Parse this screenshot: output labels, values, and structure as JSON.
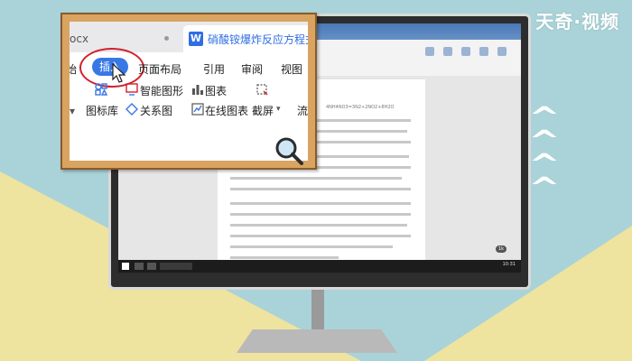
{
  "watermark": "天奇·视频",
  "wps_window": {
    "doc_tab_left": "ocx",
    "doc_tab_title": "硝酸铵爆炸反应方程式",
    "tab_icon_letter": "W",
    "menu": {
      "left_cut": "始",
      "insert": "插入",
      "layout": "页面布局",
      "references": "引用",
      "review": "审阅",
      "view": "视图"
    },
    "tools": {
      "smart_shape": "智能图形",
      "chart": "图表",
      "icon_library": "图标库",
      "relation_chart": "关系图",
      "online_chart": "在线图表",
      "screenshot": "截屏",
      "flow_cut": "流"
    }
  },
  "document": {
    "formula_line": "4NH4NO3=3N2+2NO2+8H2O"
  },
  "taskbar": {
    "zoom_badge": "1k",
    "clock": "10:31"
  },
  "colors": {
    "accent_blue": "#3877e6",
    "highlight_red": "#d3212d",
    "frame_wood": "#d9a361",
    "background_teal": "#a9d3d8",
    "background_yellow": "#efe3a0"
  }
}
